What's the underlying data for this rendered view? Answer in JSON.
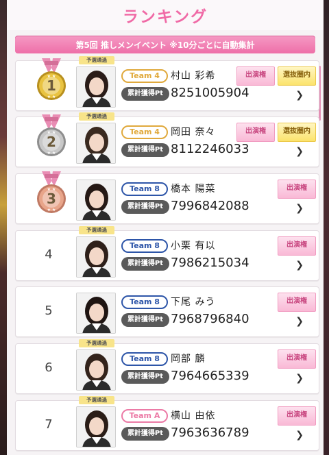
{
  "header": {
    "title": "ランキング"
  },
  "banner": {
    "text": "第5回 推しメンイベント ※10分ごとに自動集計"
  },
  "labels": {
    "pt_label": "累計獲得Pt",
    "pass_tag": "予選通過",
    "badge_appearance": "出演権",
    "badge_selection": "選抜圏内",
    "chevron": "❯"
  },
  "colors": {
    "accent_pink": "#f06aa6",
    "team4": "#e0a93c",
    "team8": "#2d55a8",
    "teamA": "#ec7aa6",
    "gold": "#e9c341",
    "silver": "#c8c8c8",
    "bronze": "#e8a58a"
  },
  "rows": [
    {
      "rank": "1",
      "medal": "gold",
      "pass": true,
      "team": "Team 4",
      "name": "村山 彩希",
      "points": "8251005904",
      "badges": [
        "出演権",
        "選抜圏内"
      ]
    },
    {
      "rank": "2",
      "medal": "silver",
      "pass": true,
      "team": "Team 4",
      "name": "岡田 奈々",
      "points": "8112246033",
      "badges": [
        "出演権",
        "選抜圏内"
      ]
    },
    {
      "rank": "3",
      "medal": "bronze",
      "pass": false,
      "team": "Team 8",
      "name": "橋本 陽菜",
      "points": "7996842088",
      "badges": [
        "出演権"
      ]
    },
    {
      "rank": "4",
      "medal": null,
      "pass": true,
      "team": "Team 8",
      "name": "小栗 有以",
      "points": "7986215034",
      "badges": [
        "出演権"
      ]
    },
    {
      "rank": "5",
      "medal": null,
      "pass": false,
      "team": "Team 8",
      "name": "下尾 みう",
      "points": "7968796840",
      "badges": [
        "出演権"
      ]
    },
    {
      "rank": "6",
      "medal": null,
      "pass": true,
      "team": "Team 8",
      "name": "岡部 麟",
      "points": "7964665339",
      "badges": [
        "出演権"
      ]
    },
    {
      "rank": "7",
      "medal": null,
      "pass": true,
      "team": "Team A",
      "name": "横山 由依",
      "points": "7963636789",
      "badges": [
        "出演権"
      ]
    }
  ]
}
